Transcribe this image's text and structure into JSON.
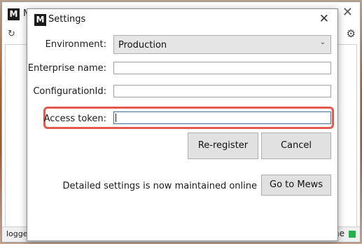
{
  "background_window": {
    "logo_letter": "M",
    "title_visible": "M",
    "close_glyph": "✕",
    "refresh_glyph": "↻",
    "gear_glyph": "⚙",
    "status_left": "logger",
    "status_right": "ine",
    "status_indicator_color": "#22b14c"
  },
  "dialog": {
    "logo_letter": "M",
    "title": "Settings",
    "close_glyph": "✕",
    "environment": {
      "label": "Environment:",
      "selected": "Production",
      "chevron": "⌄"
    },
    "enterprise_name": {
      "label": "Enterprise name:",
      "value": ""
    },
    "configuration_id": {
      "label": "ConfigurationId:",
      "value": ""
    },
    "access_token": {
      "label": "Access token:",
      "value": ""
    },
    "highlight_color": "#e2594e",
    "buttons": {
      "reregister": "Re-register",
      "cancel": "Cancel",
      "go_to_mews": "Go to Mews"
    },
    "online_note": "Detailed settings is now maintained online"
  }
}
